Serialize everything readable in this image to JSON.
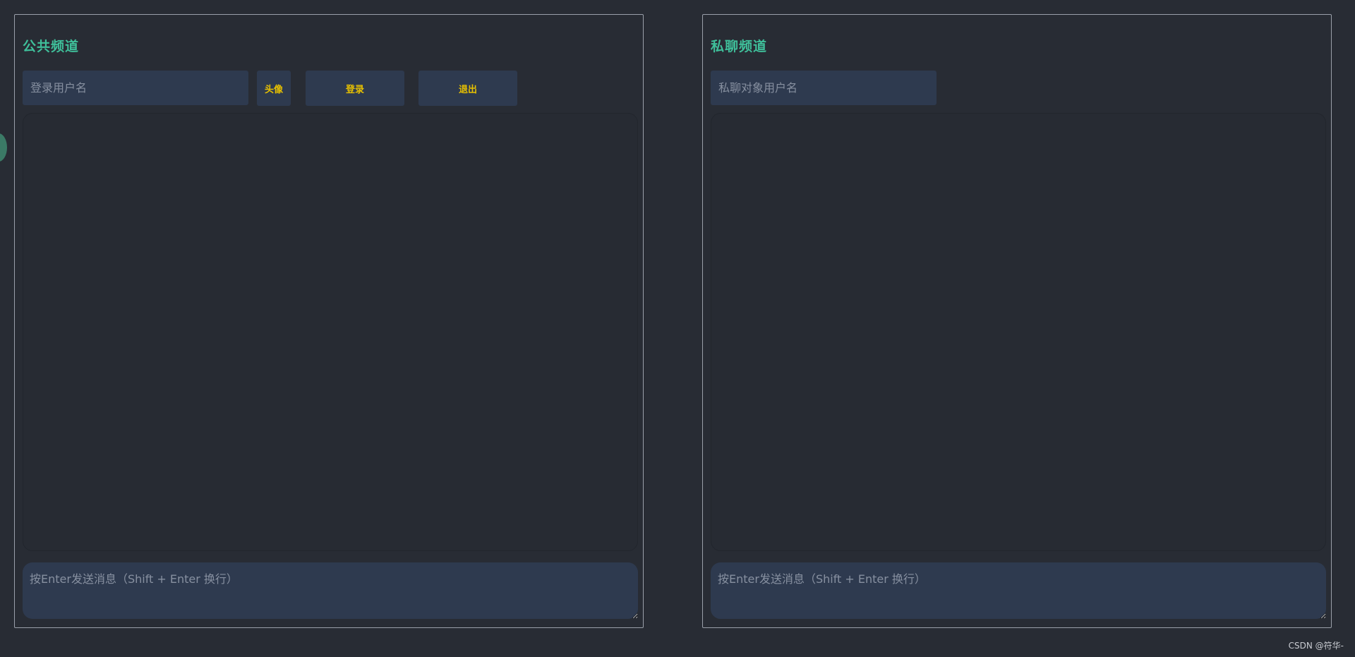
{
  "public_channel": {
    "title": "公共频道",
    "username_placeholder": "登录用户名",
    "username_value": "",
    "avatar_label": "头像",
    "login_label": "登录",
    "logout_label": "退出",
    "compose_placeholder": "按Enter发送消息（Shift + Enter 换行）"
  },
  "private_channel": {
    "title": "私聊频道",
    "target_placeholder": "私聊对象用户名",
    "target_value": "",
    "compose_placeholder": "按Enter发送消息（Shift + Enter 换行）"
  },
  "watermark": "CSDN @符华-",
  "colors": {
    "background": "#282c34",
    "title_accent": "#3fbf9a",
    "button_text": "#e8c100",
    "input_background": "#2e3a4f",
    "panel_border": "#9aa0aa"
  },
  "icons": {
    "side_toggle": "side-toggle-icon"
  }
}
